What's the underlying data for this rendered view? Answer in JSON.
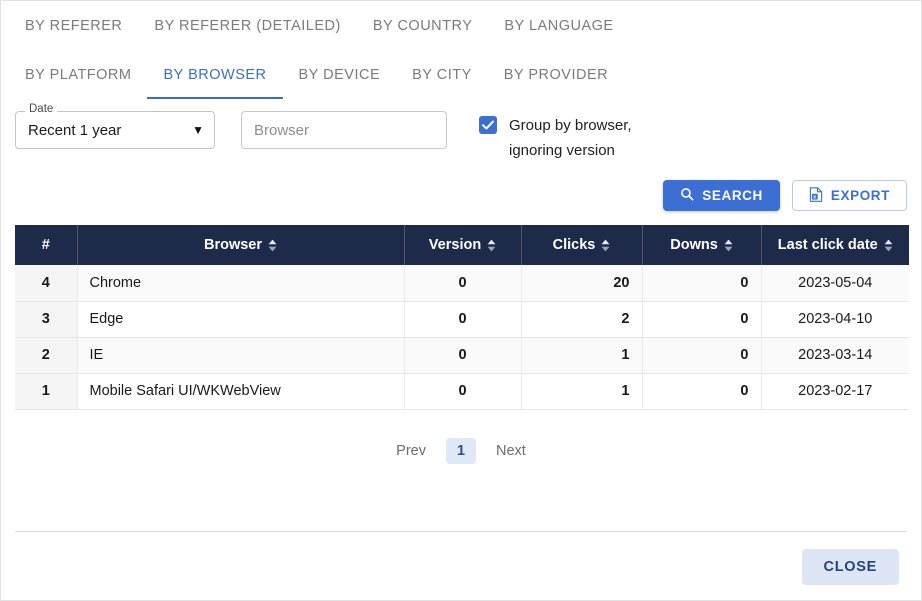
{
  "tabs": {
    "row1": [
      {
        "label": "BY REFERER",
        "active": false
      },
      {
        "label": "BY REFERER (DETAILED)",
        "active": false
      },
      {
        "label": "BY COUNTRY",
        "active": false
      },
      {
        "label": "BY LANGUAGE",
        "active": false
      }
    ],
    "row2": [
      {
        "label": "BY PLATFORM",
        "active": false
      },
      {
        "label": "BY BROWSER",
        "active": true
      },
      {
        "label": "BY DEVICE",
        "active": false
      },
      {
        "label": "BY CITY",
        "active": false
      },
      {
        "label": "BY PROVIDER",
        "active": false
      }
    ]
  },
  "filters": {
    "date_legend": "Date",
    "date_value": "Recent 1 year",
    "date_caret_icon": "chevron-down-icon",
    "browser_placeholder": "Browser",
    "browser_value": "",
    "group_checkbox_icon": "checkbox-checked-icon",
    "group_label_line1": "Group by browser,",
    "group_label_line2": "ignoring version"
  },
  "actions": {
    "search_label": "SEARCH",
    "search_icon": "search-icon",
    "export_label": "EXPORT",
    "export_icon": "excel-file-icon"
  },
  "table": {
    "sort_icon": "sort-updown-icon",
    "columns": [
      {
        "label": "#",
        "sortable": false
      },
      {
        "label": "Browser",
        "sortable": true
      },
      {
        "label": "Version",
        "sortable": true
      },
      {
        "label": "Clicks",
        "sortable": true
      },
      {
        "label": "Downs",
        "sortable": true
      },
      {
        "label": "Last click date",
        "sortable": true
      }
    ],
    "rows": [
      {
        "idx": "4",
        "browser": "Chrome",
        "version": "0",
        "clicks": "20",
        "downs": "0",
        "last_click_date": "2023-05-04"
      },
      {
        "idx": "3",
        "browser": "Edge",
        "version": "0",
        "clicks": "2",
        "downs": "0",
        "last_click_date": "2023-04-10"
      },
      {
        "idx": "2",
        "browser": "IE",
        "version": "0",
        "clicks": "1",
        "downs": "0",
        "last_click_date": "2023-03-14"
      },
      {
        "idx": "1",
        "browser": "Mobile Safari UI/WKWebView",
        "version": "0",
        "clicks": "1",
        "downs": "0",
        "last_click_date": "2023-02-17"
      }
    ]
  },
  "pagination": {
    "prev_label": "Prev",
    "pages": [
      "1"
    ],
    "current_page": "1",
    "next_label": "Next"
  },
  "footer": {
    "close_label": "CLOSE"
  },
  "colors": {
    "accent_blue": "#3b6fd4",
    "tab_active": "#3d6fc0",
    "table_header_bg": "#1e2a4a",
    "close_bg": "#dde6f4",
    "close_text": "#27437e",
    "page_active_bg": "#dfe8f6"
  }
}
